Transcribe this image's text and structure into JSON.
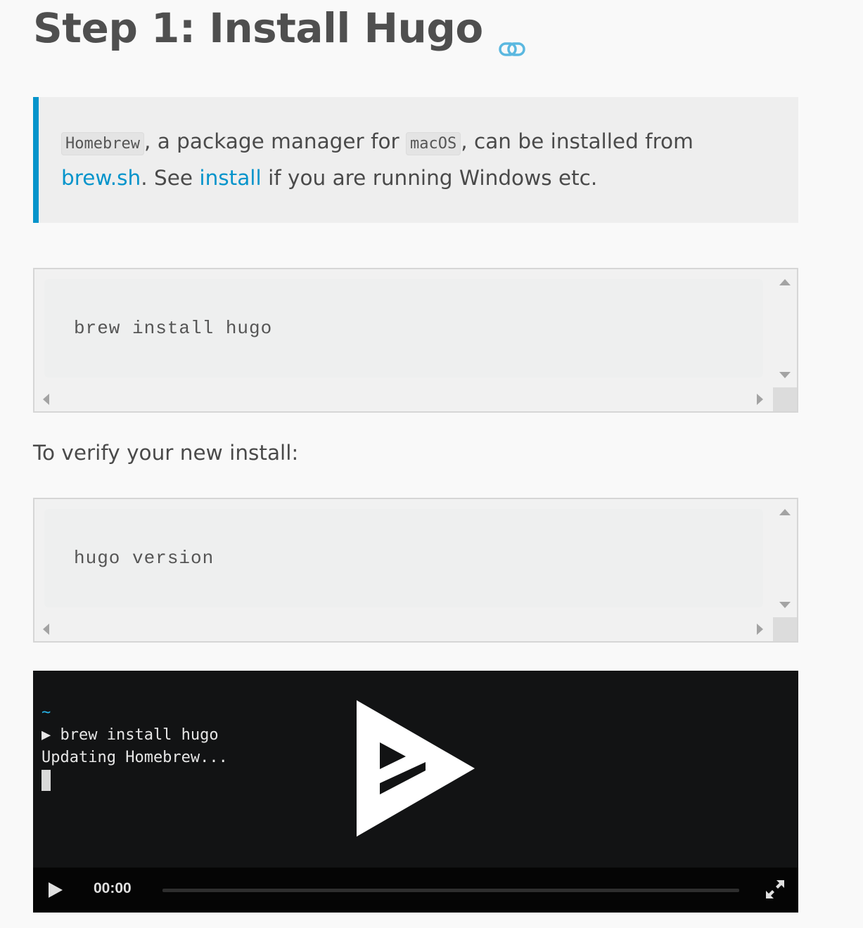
{
  "heading": {
    "title": "Step 1: Install Hugo",
    "anchor_icon": "link-icon"
  },
  "note": {
    "code1": "Homebrew",
    "text1": ", a package manager for ",
    "code2": "macOS",
    "text2": ", can be installed from",
    "link1": "brew.sh",
    "text3": ". See ",
    "link2": "install",
    "text4": " if you are running Windows etc."
  },
  "code_blocks": [
    {
      "code": "brew install hugo"
    },
    {
      "code": "hugo version"
    }
  ],
  "verify_text": "To verify your new install:",
  "player": {
    "prompt": "~",
    "line1": "▶ brew install hugo",
    "line2": "Updating Homebrew...",
    "time": "00:00",
    "progress": 0,
    "icons": [
      "asciinema-play-icon",
      "play-icon",
      "fullscreen-icon"
    ]
  },
  "colors": {
    "accent": "#0594cb",
    "player_bg": "#121314",
    "prompt": "#27b4e8"
  }
}
